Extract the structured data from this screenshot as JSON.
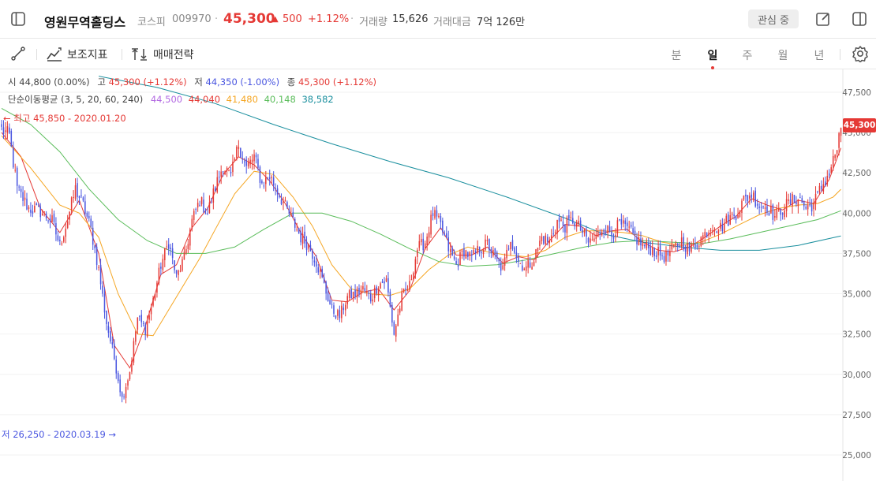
{
  "stock": {
    "name": "영원무역홀딩스",
    "market": "코스피",
    "code": "009970",
    "dot": "·",
    "price": "45,300",
    "change_arrow": "▲",
    "change": "500",
    "change_pct": "+1.12%",
    "volume_label": "거래량",
    "volume": "15,626",
    "turnover_label": "거래대금",
    "turnover": "7억 126만",
    "watch_label": "관심 중"
  },
  "toolbar": {
    "indicators_label": "보조지표",
    "strategy_label": "매매전략",
    "periods": [
      "분",
      "일",
      "주",
      "월",
      "년"
    ],
    "active_period": "일"
  },
  "ohlc": {
    "open_label": "시",
    "open": "44,800 (0.00%)",
    "high_label": "고",
    "high": "45,300 (+1.12%)",
    "low_label": "저",
    "low": "44,350 (-1.00%)",
    "close_label": "종",
    "close": "45,300 (+1.12%)"
  },
  "ma": {
    "label": "단순이동평균 (3, 5, 20, 60, 240)",
    "values": [
      {
        "value": "44,500",
        "color": "#b36ae2"
      },
      {
        "value": "44,040",
        "color": "#e53935"
      },
      {
        "value": "41,480",
        "color": "#f5a623"
      },
      {
        "value": "40,148",
        "color": "#5bbd5b"
      },
      {
        "value": "38,582",
        "color": "#1a8f9e"
      }
    ]
  },
  "annotations": {
    "high_marker": "← 최고 45,850 - 2020.01.20",
    "low_marker": "저 26,250 - 2020.03.19 →"
  },
  "colors": {
    "up": "#e53935",
    "down": "#4a56e0",
    "price_badge": "#e53935"
  },
  "chart_data": {
    "type": "candlestick",
    "y_ticks": [
      "47,500",
      "45,000",
      "42,500",
      "40,000",
      "37,500",
      "35,000",
      "32,500",
      "30,000",
      "27,500",
      "25,000"
    ],
    "ylim": [
      24000,
      48500
    ],
    "current_price_label": "45,300",
    "anchors": [
      [
        0,
        45200
      ],
      [
        4,
        44800
      ],
      [
        8,
        41500
      ],
      [
        14,
        40300
      ],
      [
        20,
        40100
      ],
      [
        26,
        39500
      ],
      [
        30,
        38000
      ],
      [
        34,
        39600
      ],
      [
        38,
        41500
      ],
      [
        42,
        40500
      ],
      [
        46,
        39000
      ],
      [
        50,
        36500
      ],
      [
        54,
        33200
      ],
      [
        58,
        31000
      ],
      [
        62,
        28500
      ],
      [
        66,
        30200
      ],
      [
        70,
        33500
      ],
      [
        74,
        32800
      ],
      [
        78,
        34600
      ],
      [
        82,
        36800
      ],
      [
        86,
        38200
      ],
      [
        90,
        36000
      ],
      [
        94,
        37200
      ],
      [
        98,
        39500
      ],
      [
        102,
        40800
      ],
      [
        106,
        40000
      ],
      [
        110,
        41600
      ],
      [
        114,
        43000
      ],
      [
        118,
        42200
      ],
      [
        122,
        44300
      ],
      [
        126,
        42800
      ],
      [
        130,
        43500
      ],
      [
        134,
        41800
      ],
      [
        138,
        42300
      ],
      [
        142,
        41400
      ],
      [
        146,
        40400
      ],
      [
        150,
        39500
      ],
      [
        154,
        38500
      ],
      [
        158,
        38000
      ],
      [
        162,
        37000
      ],
      [
        166,
        35500
      ],
      [
        170,
        34000
      ],
      [
        174,
        33600
      ],
      [
        178,
        34800
      ],
      [
        182,
        35000
      ],
      [
        186,
        35300
      ],
      [
        190,
        34700
      ],
      [
        194,
        35600
      ],
      [
        198,
        35800
      ],
      [
        202,
        32500
      ],
      [
        206,
        34800
      ],
      [
        210,
        35500
      ],
      [
        214,
        37800
      ],
      [
        218,
        38200
      ],
      [
        222,
        40000
      ],
      [
        226,
        39200
      ],
      [
        230,
        37800
      ],
      [
        234,
        36800
      ],
      [
        238,
        37700
      ],
      [
        242,
        37200
      ],
      [
        246,
        37800
      ],
      [
        250,
        38100
      ],
      [
        254,
        37200
      ],
      [
        258,
        36500
      ],
      [
        262,
        38500
      ],
      [
        266,
        37000
      ],
      [
        270,
        36600
      ],
      [
        274,
        37200
      ],
      [
        278,
        38500
      ],
      [
        282,
        38200
      ],
      [
        286,
        39500
      ],
      [
        290,
        39200
      ],
      [
        294,
        39600
      ],
      [
        298,
        39000
      ],
      [
        302,
        38200
      ],
      [
        306,
        38500
      ],
      [
        310,
        39200
      ],
      [
        314,
        38700
      ],
      [
        318,
        39300
      ],
      [
        322,
        39000
      ],
      [
        326,
        38500
      ],
      [
        330,
        38000
      ],
      [
        334,
        37800
      ],
      [
        338,
        37500
      ],
      [
        342,
        37300
      ],
      [
        346,
        37800
      ],
      [
        350,
        38300
      ],
      [
        354,
        37700
      ],
      [
        358,
        38200
      ],
      [
        362,
        38700
      ],
      [
        366,
        39300
      ],
      [
        370,
        39100
      ],
      [
        374,
        39600
      ],
      [
        378,
        40000
      ],
      [
        382,
        40800
      ],
      [
        386,
        41200
      ],
      [
        390,
        40500
      ],
      [
        394,
        40400
      ],
      [
        398,
        39800
      ],
      [
        402,
        40300
      ],
      [
        406,
        40700
      ],
      [
        410,
        41000
      ],
      [
        414,
        40300
      ],
      [
        418,
        40600
      ],
      [
        422,
        41600
      ],
      [
        426,
        42500
      ],
      [
        430,
        44000
      ],
      [
        432,
        45300
      ]
    ],
    "ma_lines": [
      {
        "name": "MA5",
        "color": "#e53935",
        "points": [
          [
            0,
            45000
          ],
          [
            10,
            43500
          ],
          [
            20,
            40300
          ],
          [
            30,
            38800
          ],
          [
            40,
            40800
          ],
          [
            50,
            37500
          ],
          [
            58,
            31800
          ],
          [
            66,
            30400
          ],
          [
            74,
            33000
          ],
          [
            82,
            36200
          ],
          [
            90,
            36800
          ],
          [
            98,
            39100
          ],
          [
            106,
            40300
          ],
          [
            114,
            42400
          ],
          [
            122,
            43500
          ],
          [
            130,
            43000
          ],
          [
            138,
            42000
          ],
          [
            146,
            40600
          ],
          [
            154,
            38800
          ],
          [
            162,
            37300
          ],
          [
            170,
            34600
          ],
          [
            178,
            34500
          ],
          [
            186,
            35100
          ],
          [
            194,
            35300
          ],
          [
            202,
            34000
          ],
          [
            210,
            35200
          ],
          [
            218,
            37800
          ],
          [
            226,
            39100
          ],
          [
            234,
            37400
          ],
          [
            242,
            37400
          ],
          [
            250,
            37900
          ],
          [
            258,
            36900
          ],
          [
            266,
            37300
          ],
          [
            274,
            37100
          ],
          [
            282,
            38300
          ],
          [
            290,
            39300
          ],
          [
            298,
            39200
          ],
          [
            306,
            38600
          ],
          [
            314,
            38900
          ],
          [
            322,
            39000
          ],
          [
            330,
            38200
          ],
          [
            338,
            37700
          ],
          [
            346,
            37600
          ],
          [
            354,
            37900
          ],
          [
            362,
            38500
          ],
          [
            370,
            39200
          ],
          [
            378,
            39800
          ],
          [
            386,
            40900
          ],
          [
            394,
            40500
          ],
          [
            402,
            40200
          ],
          [
            410,
            40800
          ],
          [
            418,
            40600
          ],
          [
            426,
            42100
          ],
          [
            432,
            44040
          ]
        ]
      },
      {
        "name": "MA20",
        "color": "#f5a623",
        "points": [
          [
            0,
            44800
          ],
          [
            15,
            42800
          ],
          [
            30,
            40500
          ],
          [
            40,
            40000
          ],
          [
            50,
            38500
          ],
          [
            60,
            35000
          ],
          [
            70,
            32500
          ],
          [
            78,
            32400
          ],
          [
            86,
            34000
          ],
          [
            94,
            35600
          ],
          [
            102,
            37200
          ],
          [
            110,
            39000
          ],
          [
            120,
            41200
          ],
          [
            130,
            42600
          ],
          [
            140,
            42400
          ],
          [
            150,
            41000
          ],
          [
            160,
            39200
          ],
          [
            170,
            36800
          ],
          [
            180,
            35300
          ],
          [
            190,
            35000
          ],
          [
            200,
            34900
          ],
          [
            210,
            35300
          ],
          [
            220,
            36500
          ],
          [
            230,
            37400
          ],
          [
            240,
            37900
          ],
          [
            250,
            37600
          ],
          [
            260,
            37400
          ],
          [
            270,
            37300
          ],
          [
            280,
            37700
          ],
          [
            290,
            38500
          ],
          [
            300,
            38900
          ],
          [
            310,
            38900
          ],
          [
            320,
            38800
          ],
          [
            330,
            38600
          ],
          [
            340,
            38200
          ],
          [
            350,
            38000
          ],
          [
            360,
            38200
          ],
          [
            370,
            38700
          ],
          [
            380,
            39300
          ],
          [
            390,
            39900
          ],
          [
            400,
            40300
          ],
          [
            410,
            40500
          ],
          [
            420,
            40600
          ],
          [
            428,
            41000
          ],
          [
            432,
            41480
          ]
        ]
      },
      {
        "name": "MA60",
        "color": "#5bbd5b",
        "points": [
          [
            0,
            46500
          ],
          [
            15,
            45500
          ],
          [
            30,
            43800
          ],
          [
            45,
            41500
          ],
          [
            60,
            39600
          ],
          [
            75,
            38300
          ],
          [
            90,
            37500
          ],
          [
            105,
            37500
          ],
          [
            120,
            37900
          ],
          [
            135,
            39000
          ],
          [
            150,
            40000
          ],
          [
            165,
            40000
          ],
          [
            180,
            39500
          ],
          [
            195,
            38700
          ],
          [
            210,
            37800
          ],
          [
            225,
            37000
          ],
          [
            240,
            36700
          ],
          [
            255,
            36800
          ],
          [
            270,
            37100
          ],
          [
            285,
            37500
          ],
          [
            300,
            37900
          ],
          [
            315,
            38200
          ],
          [
            330,
            38300
          ],
          [
            345,
            38200
          ],
          [
            360,
            38100
          ],
          [
            375,
            38400
          ],
          [
            390,
            38800
          ],
          [
            405,
            39200
          ],
          [
            420,
            39600
          ],
          [
            432,
            40148
          ]
        ]
      },
      {
        "name": "MA240",
        "color": "#1a8f9e",
        "points": [
          [
            50,
            48500
          ],
          [
            80,
            47800
          ],
          [
            110,
            46800
          ],
          [
            140,
            45500
          ],
          [
            170,
            44300
          ],
          [
            200,
            43200
          ],
          [
            230,
            42200
          ],
          [
            260,
            41000
          ],
          [
            290,
            39700
          ],
          [
            310,
            38700
          ],
          [
            330,
            38200
          ],
          [
            350,
            37900
          ],
          [
            370,
            37700
          ],
          [
            390,
            37700
          ],
          [
            410,
            38000
          ],
          [
            432,
            38582
          ]
        ]
      }
    ]
  }
}
